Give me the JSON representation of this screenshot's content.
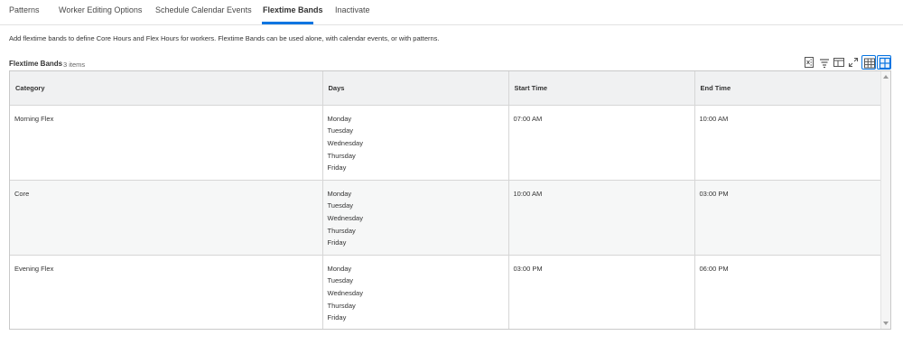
{
  "tabs": [
    {
      "label": "Patterns",
      "active": false
    },
    {
      "label": "Worker Editing Options",
      "active": false
    },
    {
      "label": "Schedule Calendar Events",
      "active": false
    },
    {
      "label": "Flextime Bands",
      "active": true
    },
    {
      "label": "Inactivate",
      "active": false
    }
  ],
  "description": "Add flextime bands to define Core Hours and Flex Hours for workers. Flextime Bands can be used alone, with calendar events, or with patterns.",
  "grid": {
    "title": "Flextime Bands",
    "count": "3 items",
    "toolbar": [
      {
        "icon": "excel-export-icon"
      },
      {
        "icon": "filter-icon"
      },
      {
        "icon": "columns-icon"
      },
      {
        "icon": "expand-icon"
      },
      {
        "icon": "table-view-icon"
      },
      {
        "icon": "grid-view-icon"
      }
    ],
    "columns": [
      "Category",
      "Days",
      "Start Time",
      "End Time"
    ],
    "rows": [
      {
        "category": "Morning Flex",
        "days": [
          "Monday",
          "Tuesday",
          "Wednesday",
          "Thursday",
          "Friday"
        ],
        "start": "07:00 AM",
        "end": "10:00 AM"
      },
      {
        "category": "Core",
        "days": [
          "Monday",
          "Tuesday",
          "Wednesday",
          "Thursday",
          "Friday"
        ],
        "start": "10:00 AM",
        "end": "03:00 PM"
      },
      {
        "category": "Evening Flex",
        "days": [
          "Monday",
          "Tuesday",
          "Wednesday",
          "Thursday",
          "Friday"
        ],
        "start": "03:00 PM",
        "end": "06:00 PM"
      }
    ]
  },
  "colors": {
    "accent": "#0875e1",
    "header_bg": "#f0f1f2",
    "alt_row_bg": "#f6f7f7"
  }
}
